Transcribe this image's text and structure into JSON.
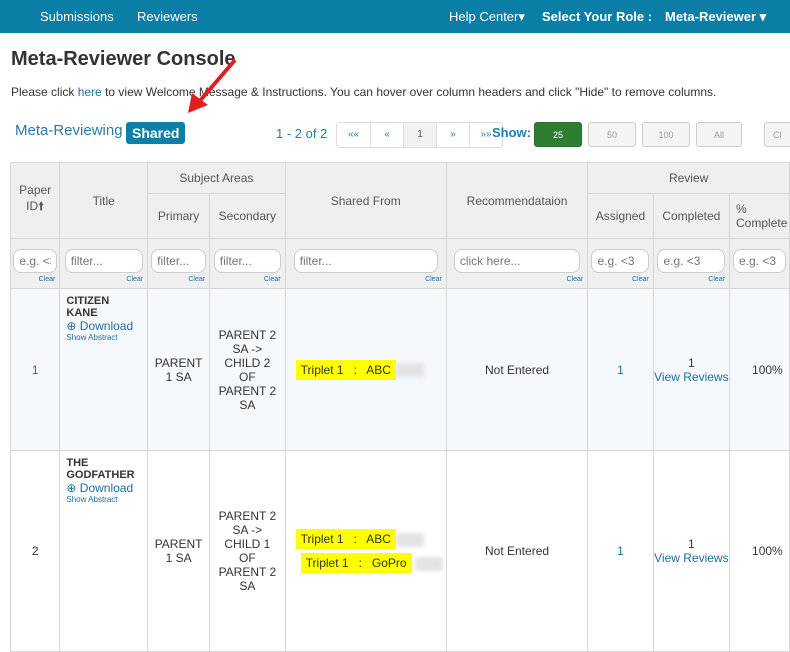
{
  "nav": {
    "submissions": "Submissions",
    "reviewers": "Reviewers",
    "help": "Help Center",
    "role_label": "Select Your Role :",
    "role": "Meta-Reviewer"
  },
  "title": "Meta-Reviewer Console",
  "intro": {
    "pre": "Please click ",
    "link": "here",
    "post": " to view Welcome Message & Instructions. You can hover over column headers and click \"Hide\" to remove columns."
  },
  "tabs": {
    "meta": "Meta-Reviewing",
    "shared": "Shared"
  },
  "pagination": {
    "count": "1 - 2 of 2",
    "first": "««",
    "prev": "«",
    "page": "1",
    "next": "»",
    "last": "»»"
  },
  "show": {
    "label": "Show:",
    "options": [
      "25",
      "50",
      "100",
      "All"
    ],
    "selected": "25",
    "clear": "Cl"
  },
  "headers": {
    "paper_id": "Paper ID",
    "title": "Title",
    "subject_areas": "Subject Areas",
    "primary": "Primary",
    "secondary": "Secondary",
    "shared_from": "Shared From",
    "recommendation": "Recommendataion",
    "review": "Review",
    "assigned": "Assigned",
    "completed": "Completed",
    "pct": "% Complete"
  },
  "filters": {
    "id": "e.g. <3",
    "title": "filter...",
    "primary": "filter...",
    "secondary": "filter...",
    "shared": "filter...",
    "rec": "click here...",
    "assigned": "e.g. <3",
    "completed": "e.g. <3",
    "pct": "e.g. <3",
    "clear": "Clear"
  },
  "rows": [
    {
      "id": "1",
      "title": "CITIZEN KANE",
      "download": "Download",
      "abstract": "Show Abstract",
      "primary": "PARENT 1 SA",
      "secondary": "PARENT 2 SA -> CHILD 2 OF PARENT 2 SA",
      "shared": [
        {
          "triplet": "Triplet 1",
          "sep": ":",
          "name": "ABC"
        }
      ],
      "rec": "Not Entered",
      "assigned": "1",
      "completed": "",
      "view": "View Reviews",
      "pct": "100%"
    },
    {
      "id": "2",
      "title": "THE GODFATHER",
      "download": "Download",
      "abstract": "Show Abstract",
      "primary": "PARENT 1 SA",
      "secondary": "PARENT 2 SA -> CHILD 1 OF PARENT 2 SA",
      "shared": [
        {
          "triplet": "Triplet 1",
          "sep": ":",
          "name": "ABC"
        },
        {
          "triplet": "Triplet 1",
          "sep": ":",
          "name": "GoPro"
        }
      ],
      "rec": "Not Entered",
      "assigned": "1",
      "completed": "1",
      "view": "View Reviews",
      "pct": "100%"
    }
  ],
  "colors": {
    "nav": "#0b7ea6",
    "active_show": "#2e7d32",
    "highlight": "#ffff00",
    "arrow": "#e02020"
  }
}
